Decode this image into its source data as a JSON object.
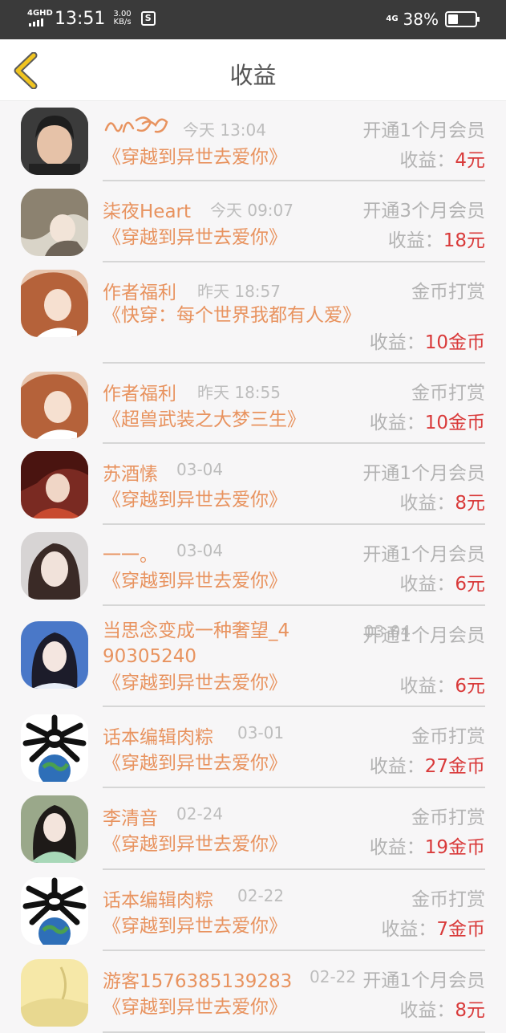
{
  "status_bar": {
    "network_label": "4GHD",
    "time": "13:51",
    "speed_value": "3.00",
    "speed_unit": "KB/s",
    "network2": "4G",
    "battery": "38%",
    "battery_level": 0.38
  },
  "header": {
    "title": "收益",
    "back_icon": "chevron-left-icon"
  },
  "earn_label": "收益：",
  "records": [
    {
      "name": "",
      "time": "今天 13:04",
      "type": "开通1个月会员",
      "book": "《穿越到异世去爱你》",
      "amount": "4元"
    },
    {
      "name": "柒夜Heart",
      "time": "今天 09:07",
      "type": "开通3个月会员",
      "book": "《穿越到异世去爱你》",
      "amount": "18元"
    },
    {
      "name": "作者福利",
      "time": "昨天 18:57",
      "type": "金币打赏",
      "book": "《快穿：每个世界我都有人爱》",
      "amount": "10金币"
    },
    {
      "name": "作者福利",
      "time": "昨天 18:55",
      "type": "金币打赏",
      "book": "《超兽武装之大梦三生》",
      "amount": "10金币"
    },
    {
      "name": "苏酒愫",
      "time": "03-04",
      "type": "开通1个月会员",
      "book": "《穿越到异世去爱你》",
      "amount": "8元"
    },
    {
      "name": "一一。",
      "time": "03-04",
      "type": "开通1个月会员",
      "book": "《穿越到异世去爱你》",
      "amount": "6元"
    },
    {
      "name": "当思念变成一种奢望_490305240",
      "time": "03-04",
      "type": "开通1个月会员",
      "book": "《穿越到异世去爱你》",
      "amount": "6元"
    },
    {
      "name": "话本编辑肉粽",
      "time": "03-01",
      "type": "金币打赏",
      "book": "《穿越到异世去爱你》",
      "amount": "27金币"
    },
    {
      "name": "李清音",
      "time": "02-24",
      "type": "金币打赏",
      "book": "《穿越到异世去爱你》",
      "amount": "19金币"
    },
    {
      "name": "话本编辑肉粽",
      "time": "02-22",
      "type": "金币打赏",
      "book": "《穿越到异世去爱你》",
      "amount": "7金币"
    },
    {
      "name": "游客1576385139283",
      "time": "02-22",
      "type": "开通1个月会员",
      "book": "《穿越到异世去爱你》",
      "amount": "8元"
    }
  ]
}
